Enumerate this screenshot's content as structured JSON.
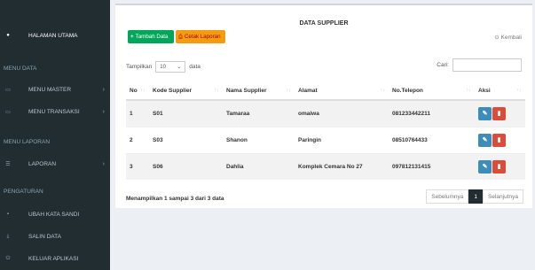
{
  "sidebar": {
    "main_label": "HALAMAN UTAMA",
    "section1": "MENU DATA",
    "master": "MENU MASTER",
    "transaksi": "MENU TRANSAKSI",
    "section2": "MENU LAPORAN",
    "laporan": "LAPORAN",
    "section3": "PENGATURAN",
    "ubah": "UBAH KATA SANDI",
    "salin": "SALIN DATA",
    "keluar": "KELUAR APLIKASI"
  },
  "header": {
    "title": "DATA SUPPLIER",
    "add_label": "Tambah Data",
    "print_label": "Cetak Laporan",
    "back_label": "Kembali"
  },
  "controls": {
    "show_prefix": "Tampilkan",
    "page_size": "10",
    "show_suffix": "data",
    "search_label": "Cari:"
  },
  "table": {
    "columns": [
      "No",
      "Kode Supplier",
      "Nama Supplier",
      "Alamat",
      "No.Telepon",
      "Aksi"
    ],
    "rows": [
      [
        "1",
        "S01",
        "Tamaraa",
        "omaiwa",
        "081233442211"
      ],
      [
        "2",
        "S03",
        "Shanon",
        "Paringin",
        "08510764433"
      ],
      [
        "3",
        "S06",
        "Dahlia",
        "Komplek Cemara No 27",
        "097812131415"
      ]
    ]
  },
  "footer": {
    "info": "Menampilkan 1 sampai 3 dari 3 data",
    "prev": "Sebelumnya",
    "page": "1",
    "next": "Selanjutnya"
  }
}
